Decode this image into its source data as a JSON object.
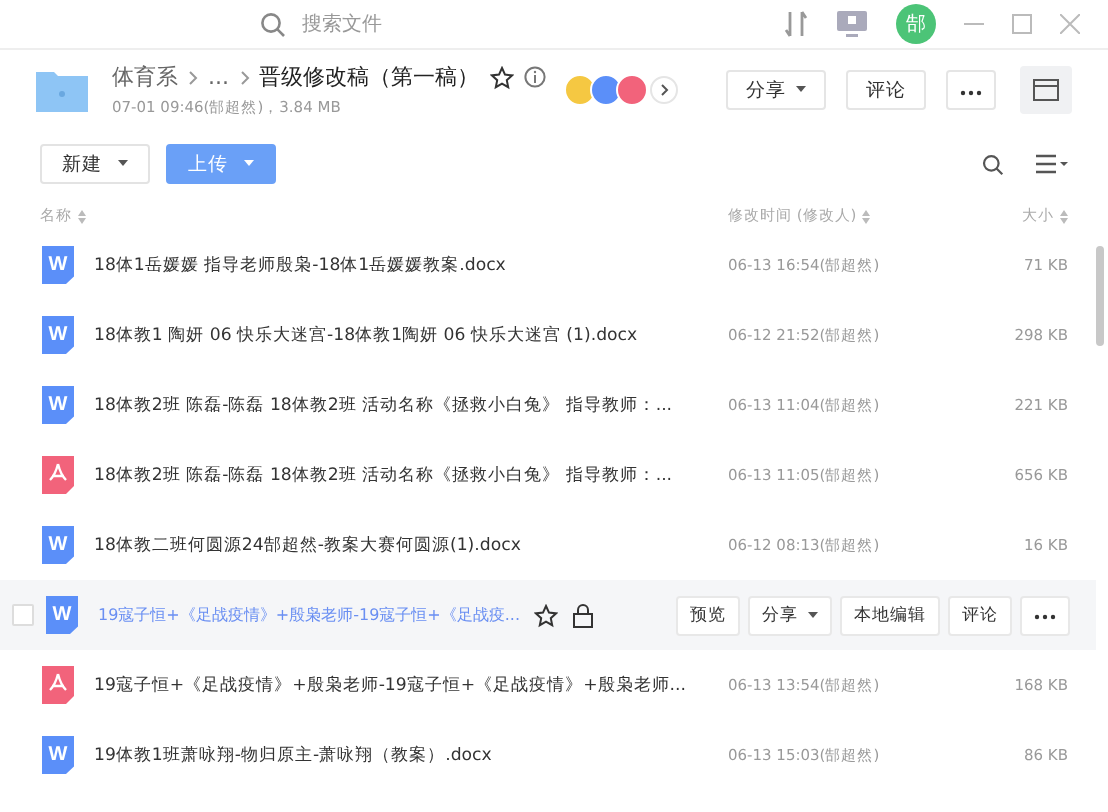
{
  "topbar": {
    "search_placeholder": "搜索文件",
    "user_initial": "郜"
  },
  "header": {
    "breadcrumb": [
      "体育系",
      "...",
      "晋级修改稿（第一稿）"
    ],
    "starred": false,
    "meta": "07-01 09:46(郜超然)，3.84 MB",
    "avatars": [
      {
        "color": "#f5c842"
      },
      {
        "color": "#5b8ff9"
      },
      {
        "color": "#f2637b"
      }
    ],
    "buttons": [
      {
        "label": "分享",
        "kind": "dropdown"
      },
      {
        "label": "评论",
        "kind": "plain"
      }
    ]
  },
  "toolbar": {
    "new_label": "新建",
    "upload_label": "上传"
  },
  "columns": [
    "名称",
    "修改时间 (修改人)",
    "大小"
  ],
  "rows": [
    {
      "kind": "word",
      "icon_letter": "W",
      "name": "18体1岳媛媛 指导老师殷枭-18体1岳媛媛教案.docx",
      "time": "06-13 16:54(郜超然)",
      "size": "71 KB",
      "hovered": false
    },
    {
      "kind": "word",
      "icon_letter": "W",
      "name": "18体教1 陶妍 06 快乐大迷宫-18体教1陶妍 06 快乐大迷宫 (1).docx",
      "time": "06-12 21:52(郜超然)",
      "size": "298 KB",
      "hovered": false
    },
    {
      "kind": "word",
      "icon_letter": "W",
      "name": "18体教2班 陈磊-陈磊 18体教2班 活动名称《拯救小白兔》 指导教师：...",
      "time": "06-13 11:04(郜超然)",
      "size": "221 KB",
      "hovered": false
    },
    {
      "kind": "pdf",
      "name": "18体教2班 陈磊-陈磊 18体教2班 活动名称《拯救小白兔》 指导教师：...",
      "time": "06-13 11:05(郜超然)",
      "size": "656 KB",
      "hovered": false
    },
    {
      "kind": "word",
      "icon_letter": "W",
      "name": "18体教二班何圆源24郜超然-教案大赛何圆源(1).docx",
      "time": "06-12 08:13(郜超然)",
      "size": "16 KB",
      "hovered": false
    },
    {
      "kind": "word",
      "icon_letter": "W",
      "name": "19寇子恒+《足战疫情》+殷枭老师-19寇子恒+《足战疫...",
      "time": "",
      "size": "",
      "hovered": true
    },
    {
      "kind": "pdf",
      "name": "19寇子恒+《足战疫情》+殷枭老师-19寇子恒+《足战疫情》+殷枭老师...",
      "time": "06-13 13:54(郜超然)",
      "size": "168 KB",
      "hovered": false
    },
    {
      "kind": "word",
      "icon_letter": "W",
      "name": "19体教1班萧咏翔-物归原主-萧咏翔（教案）.docx",
      "time": "06-13 15:03(郜超然)",
      "size": "86 KB",
      "hovered": false
    }
  ],
  "row_actions": [
    {
      "label": "预览",
      "kind": "plain"
    },
    {
      "label": "分享",
      "kind": "dropdown"
    },
    {
      "label": "本地编辑",
      "kind": "plain"
    },
    {
      "label": "评论",
      "kind": "plain"
    }
  ]
}
